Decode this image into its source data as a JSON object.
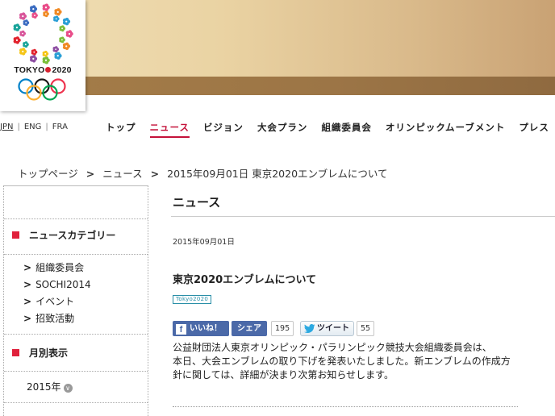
{
  "logo": {
    "text_left": "TOKYO",
    "text_right": "2020"
  },
  "language": {
    "items": [
      "JPN",
      "ENG",
      "FRA"
    ],
    "active": "JPN"
  },
  "nav": {
    "items": [
      "トップ",
      "ニュース",
      "ビジョン",
      "大会プラン",
      "組織委員会",
      "オリンピックムーブメント",
      "プレス"
    ],
    "active": "ニュース"
  },
  "breadcrumb": {
    "items": [
      "トップページ",
      "ニュース",
      "2015年09月01日 東京2020エンブレムについて"
    ]
  },
  "sidebar": {
    "category_heading": "ニュースカテゴリー",
    "categories": [
      "組織委員会",
      "SOCHI2014",
      "イベント",
      "招致活動"
    ],
    "monthly_heading": "月別表示",
    "year": "2015年"
  },
  "main": {
    "section_title": "ニュース",
    "date": "2015年09月01日",
    "headline": "東京2020エンブレムについて",
    "tag": "Tokyo2020",
    "social": {
      "like_label": "いいね！",
      "share_label": "シェア",
      "share_count": "195",
      "tweet_label": "ツイート",
      "tweet_count": "55"
    },
    "body_lines": [
      "公益財団法人東京オリンピック・パラリンピック競技大会組織委員会は、",
      "本日、大会エンブレムの取り下げを発表いたしました。新エンブレムの作成方",
      "針に関しては、詳細が決まり次第お知らせします。"
    ]
  },
  "colors": {
    "accent": "#c4123a",
    "category_marker": "#e0213c",
    "facebook": "#4b69a8",
    "banner_band": "#a57d48"
  }
}
